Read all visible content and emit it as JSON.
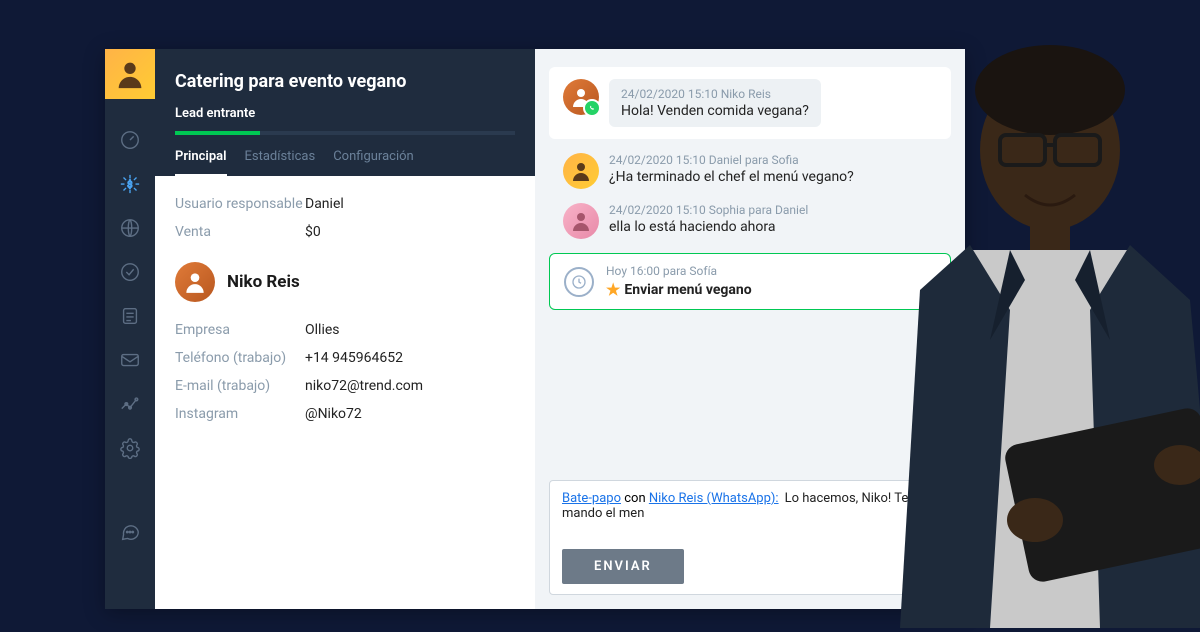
{
  "lead": {
    "title": "Catering para evento vegano",
    "stage": "Lead entrante",
    "tabs": {
      "main": "Principal",
      "stats": "Estadísticas",
      "config": "Configuración"
    },
    "fields": {
      "responsible_label": "Usuario responsable",
      "responsible_value": "Daniel",
      "sale_label": "Venta",
      "sale_value": "$0"
    },
    "contact": {
      "name": "Niko Reis",
      "company_label": "Empresa",
      "company_value": "Ollies",
      "phone_label": "Teléfono (trabajo)",
      "phone_value": "+14 945964652",
      "email_label": "E-mail (trabajo)",
      "email_value": "niko72@trend.com",
      "instagram_label": "Instagram",
      "instagram_value": "@Niko72"
    }
  },
  "chat": {
    "msg1": {
      "meta": "24/02/2020 15:10 Niko Reis",
      "text": "Hola! Venden comida vegana?"
    },
    "msg2": {
      "meta": "24/02/2020 15:10 Daniel para Sofia",
      "text": "¿Ha terminado el chef el menú vegano?"
    },
    "msg3": {
      "meta": "24/02/2020 15:10 Sophia para Daniel",
      "text": "ella lo está haciendo ahora"
    },
    "task": {
      "meta": "Hoy 16:00 para Sofía",
      "title": "Enviar menú vegano"
    },
    "composer": {
      "link_chat": "Bate-papo",
      "with": " con ",
      "link_who": "Niko Reis (WhatsApp):",
      "typed": "Lo hacemos, Niko! Te mando el men",
      "send": "ENVIAR"
    }
  }
}
